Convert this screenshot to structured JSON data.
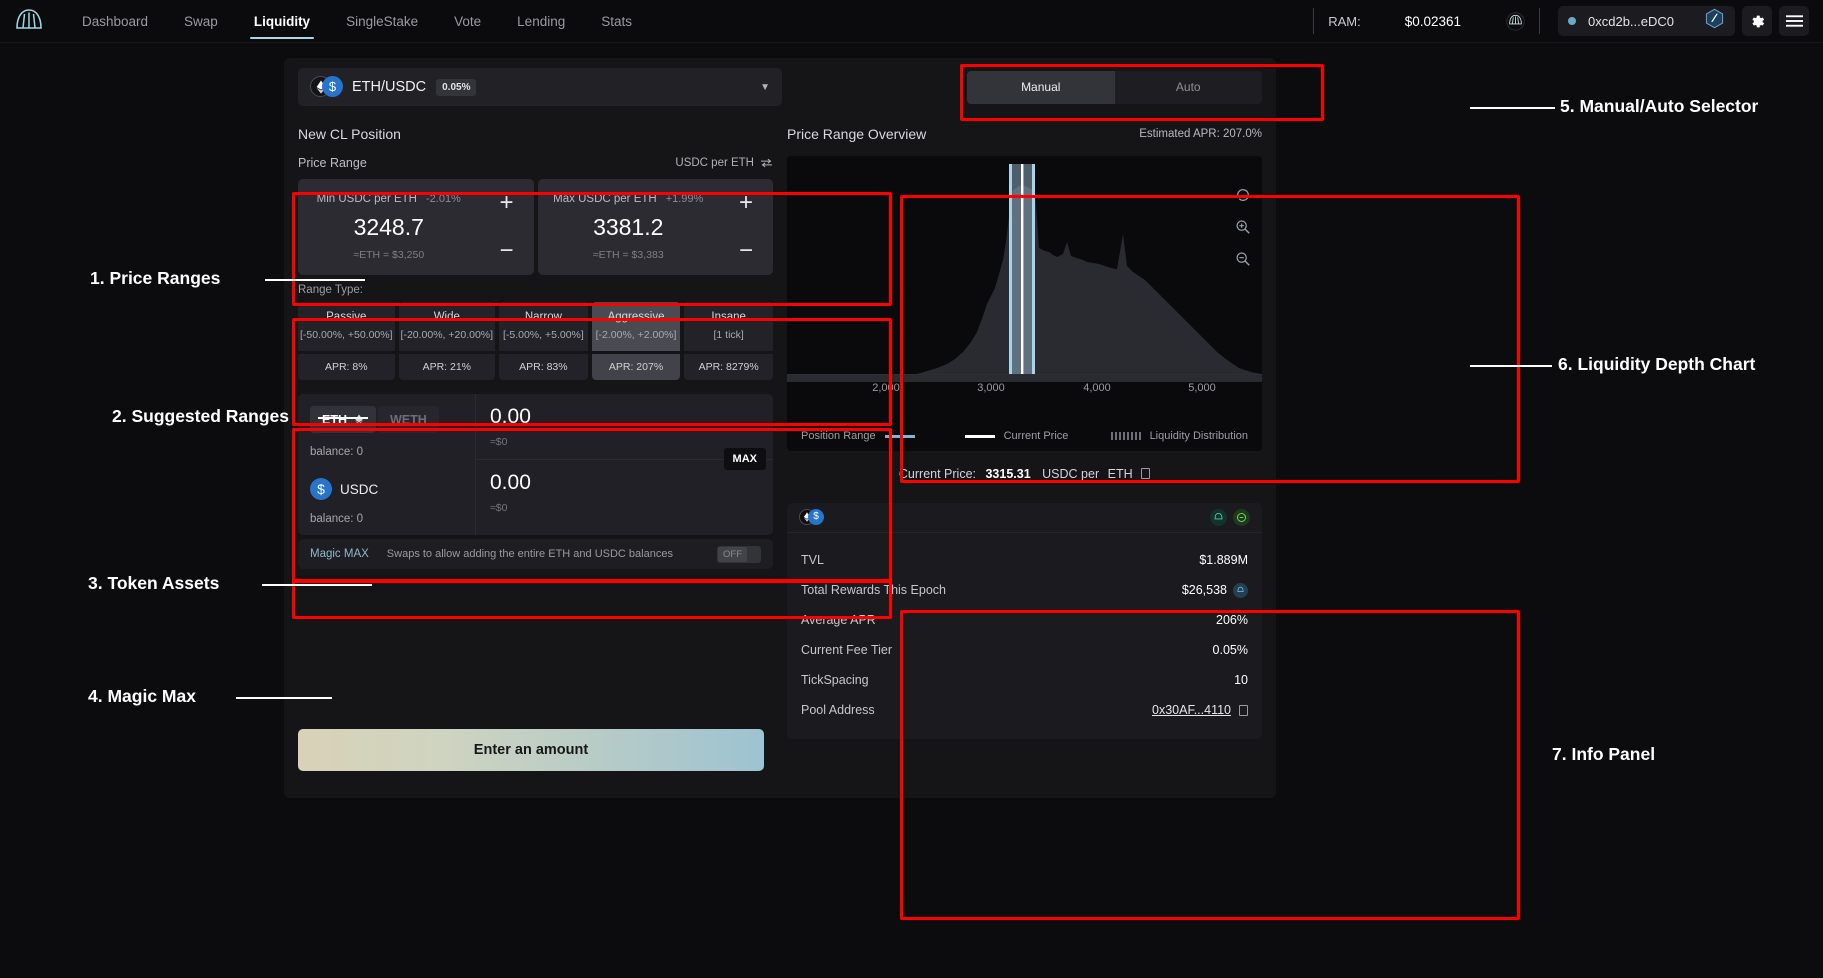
{
  "nav": {
    "logo_icon": "shadow-logo-icon",
    "links": [
      {
        "label": "Dashboard",
        "active": false
      },
      {
        "label": "Swap",
        "active": false
      },
      {
        "label": "Liquidity",
        "active": true
      },
      {
        "label": "SingleStake",
        "active": false
      },
      {
        "label": "Vote",
        "active": false
      },
      {
        "label": "Lending",
        "active": false
      },
      {
        "label": "Stats",
        "active": false
      }
    ],
    "ram_label": "RAM:",
    "ram_value": "$0.02361",
    "wallet_address": "0xcd2b...eDC0",
    "settings_icon": "gear-icon",
    "menu_icon": "hamburger-icon"
  },
  "pool": {
    "pair": "ETH/USDC",
    "fee_tier": "0.05%",
    "dropdown_icon": "chevron-down-icon"
  },
  "mode": {
    "manual": "Manual",
    "auto": "Auto",
    "selected": "Manual"
  },
  "left": {
    "title": "New CL Position",
    "price_range_label": "Price Range",
    "denom_label": "USDC per ETH",
    "flip_icon": "swap-arrows-icon",
    "min": {
      "label": "Min USDC per ETH",
      "pct": "-2.01%",
      "value": "3248.7",
      "sub": "≈ETH = $3,250"
    },
    "max": {
      "label": "Max USDC per ETH",
      "pct": "+1.99%",
      "value": "3381.2",
      "sub": "≈ETH = $3,383"
    },
    "range_type_label": "Range Type:",
    "suggested": [
      {
        "name": "Passive",
        "pct": "[-50.00%, +50.00%]",
        "apr": "APR: 8%",
        "selected": false
      },
      {
        "name": "Wide",
        "pct": "[-20.00%, +20.00%]",
        "apr": "APR: 21%",
        "selected": false
      },
      {
        "name": "Narrow",
        "pct": "[-5.00%, +5.00%]",
        "apr": "APR: 83%",
        "selected": false
      },
      {
        "name": "Aggressive",
        "pct": "[-2.00%, +2.00%]",
        "apr": "APR: 207%",
        "selected": true
      },
      {
        "name": "Insane",
        "pct": "[1 tick]",
        "apr": "APR: 8279%",
        "selected": false
      }
    ],
    "tokens": {
      "eth_label": "ETH",
      "weth_label": "WETH",
      "eth_balance": "balance: 0",
      "usdc_label": "USDC",
      "usdc_balance": "balance: 0",
      "eth_amount": "0.00",
      "eth_amount_usd": "≈$0",
      "usdc_amount": "0.00",
      "usdc_amount_usd": "≈$0",
      "max_label": "MAX"
    },
    "magic_max": {
      "label": "Magic MAX",
      "description": "Swaps to allow adding the entire ETH and USDC balances",
      "toggle_state": "OFF"
    },
    "cta": "Enter an amount"
  },
  "right": {
    "title": "Price Range Overview",
    "estimated_apr": "Estimated APR: 207.0%",
    "tools": [
      {
        "icon": "reset-zoom-icon"
      },
      {
        "icon": "zoom-in-icon"
      },
      {
        "icon": "zoom-out-icon"
      }
    ],
    "legend": {
      "position_range": "Position Range",
      "current_price": "Current Price",
      "liquidity_distribution": "Liquidity Distribution"
    },
    "current_price": {
      "label": "Current Price:",
      "value": "3315.31",
      "unit_a": "USDC per",
      "unit_b": "ETH",
      "copy_icon": "copy-icon"
    },
    "info": {
      "header_icons": [
        "pair-icon",
        "shadow-badge-icon",
        "sonic-badge-icon"
      ],
      "rows": [
        {
          "key": "TVL",
          "value": "$1.889M"
        },
        {
          "key": "Total Rewards This Epoch",
          "value": "$26,538",
          "badge": "x"
        },
        {
          "key": "Average APR",
          "value": "206%"
        },
        {
          "key": "Current Fee Tier",
          "value": "0.05%"
        },
        {
          "key": "TickSpacing",
          "value": "10"
        },
        {
          "key": "Pool Address",
          "value": "0x30AF...4110",
          "link": true,
          "copy": true
        }
      ]
    }
  },
  "chart_data": {
    "type": "area",
    "title": "Price Range Overview",
    "xlabel": "",
    "ylabel": "",
    "xlim": [
      1500,
      5600
    ],
    "ticks": [
      2000,
      3000,
      4000,
      5000
    ],
    "tick_labels": [
      "2,000",
      "3,000",
      "4,000",
      "5,000"
    ],
    "grid": false,
    "legend_position": "bottom",
    "current_price": 3315.31,
    "position_range": [
      3248.7,
      3381.2
    ],
    "series": [
      {
        "name": "Liquidity Distribution",
        "x": [
          1500,
          1700,
          1900,
          2100,
          2300,
          2500,
          2650,
          2750,
          2850,
          2900,
          2950,
          3000,
          3050,
          3080,
          3110,
          3140,
          3170,
          3200,
          3230,
          3250,
          3270,
          3300,
          3330,
          3360,
          3390,
          3420,
          3450,
          3480,
          3520,
          3560,
          3600,
          3650,
          3700,
          3760,
          3820,
          3880,
          3940,
          4000,
          4060,
          4120,
          4180,
          4240,
          4300,
          4360,
          4420,
          4480,
          4540,
          4600,
          4700,
          4800,
          4900,
          5000,
          5100,
          5200,
          5300,
          5400,
          5500
        ],
        "values": [
          0,
          0,
          0,
          0,
          0,
          0,
          1,
          2,
          3,
          5,
          7,
          10,
          14,
          18,
          24,
          30,
          44,
          52,
          68,
          100,
          97,
          95,
          93,
          90,
          60,
          58,
          56,
          53,
          50,
          48,
          62,
          47,
          46,
          45,
          43,
          42,
          41,
          40,
          38,
          37,
          36,
          34,
          32,
          30,
          28,
          26,
          24,
          22,
          18,
          14,
          11,
          8,
          6,
          4,
          3,
          1,
          0
        ]
      }
    ]
  },
  "annotations": [
    {
      "id": "1",
      "label": "1. Price Ranges"
    },
    {
      "id": "2",
      "label": "2. Suggested Ranges"
    },
    {
      "id": "3",
      "label": "3. Token Assets"
    },
    {
      "id": "4",
      "label": "4. Magic Max"
    },
    {
      "id": "5",
      "label": "5. Manual/Auto Selector"
    },
    {
      "id": "6",
      "label": "6. Liquidity Depth Chart"
    },
    {
      "id": "7",
      "label": "7. Info Panel"
    }
  ]
}
